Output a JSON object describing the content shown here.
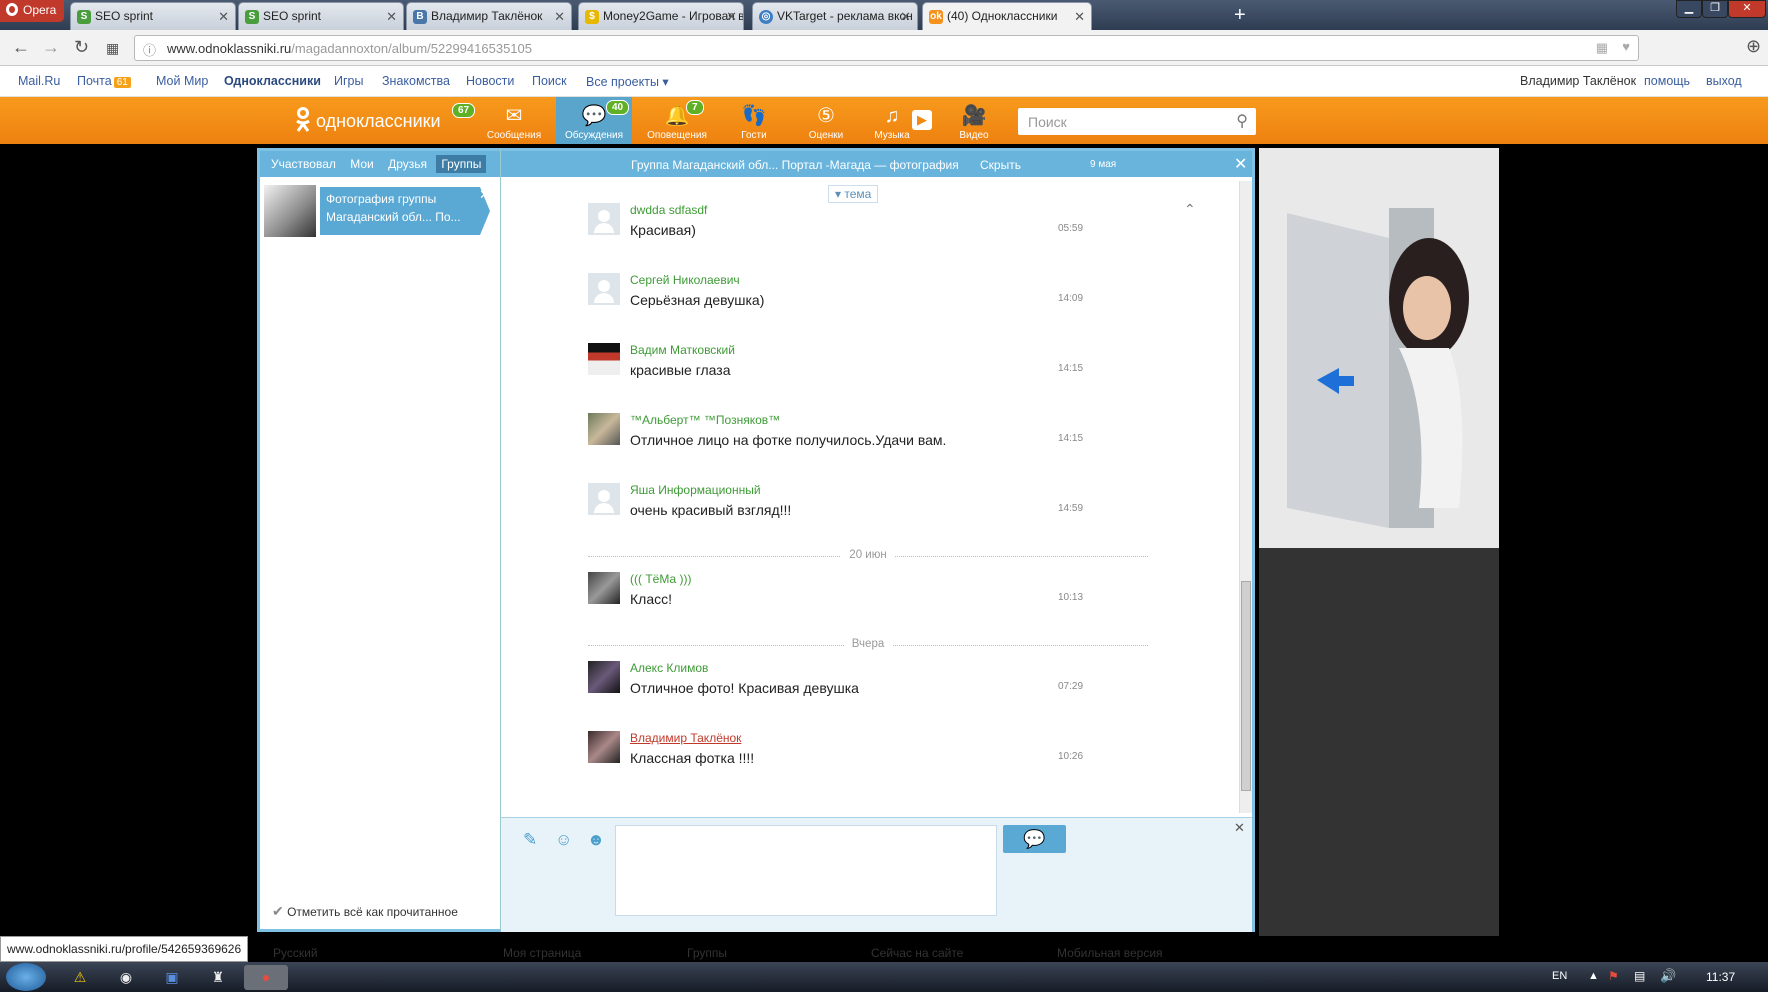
{
  "browser": {
    "app_name": "Opera",
    "tabs": [
      {
        "label": "SEO sprint",
        "icon": "seo-sprint-icon"
      },
      {
        "label": "SEO sprint",
        "icon": "seo-sprint-icon"
      },
      {
        "label": "Владимир Таклёнок",
        "icon": "vk-icon"
      },
      {
        "label": "Money2Game - Игровая в",
        "icon": "money2game-icon"
      },
      {
        "label": "VKTarget - реклама вкон",
        "icon": "vktarget-icon"
      },
      {
        "label": "(40) Одноклассники",
        "icon": "odnoklassniki-icon",
        "active": true
      }
    ],
    "url_host": "www.odnoklassniki.ru",
    "url_path": "/magadannoxton/album/52299416535105"
  },
  "portal": {
    "links": [
      "Mail.Ru",
      "Почта",
      "Мой Мир",
      "Одноклассники",
      "Игры",
      "Знакомства",
      "Новости",
      "Поиск",
      "Все проекты ▾"
    ],
    "mail_count": "61",
    "user_name": "Владимир Таклёнок",
    "help": "помощь",
    "logout": "выход"
  },
  "header": {
    "logo": "одноклассники",
    "logo_badge": "67",
    "nav": [
      {
        "label": "Сообщения",
        "icon": "envelope-icon",
        "badge": ""
      },
      {
        "label": "Обсуждения",
        "icon": "discussions-icon",
        "badge": "40"
      },
      {
        "label": "Оповещения",
        "icon": "bell-icon",
        "badge": "7"
      },
      {
        "label": "Гости",
        "icon": "footprints-icon",
        "badge": ""
      },
      {
        "label": "Оценки",
        "icon": "rating-icon",
        "badge": ""
      },
      {
        "label": "Музыка",
        "icon": "music-icon",
        "badge": ""
      },
      {
        "label": "Видео",
        "icon": "video-icon",
        "badge": ""
      }
    ],
    "search_placeholder": "Поиск"
  },
  "left": {
    "tabs": [
      "Участвовал",
      "Мои",
      "Друзья",
      "Группы"
    ],
    "conversation": "Фотография группы Магаданский обл... По...",
    "mark_all": "Отметить всё как прочитанное"
  },
  "chat": {
    "title": "Группа Магаданский обл... Портал -Магада — фотография",
    "hide": "Скрыть",
    "date": "9 мая",
    "topic_label": "▾ тема",
    "messages": [
      {
        "name": "dwdda sdfasdf",
        "text": "Красивая)",
        "time": "05:59"
      },
      {
        "name": "Сергей Николаевич",
        "text": "Серьёзная девушка)",
        "time": "14:09"
      },
      {
        "name": "Вадим Матковский",
        "text": "красивые глаза",
        "time": "14:15"
      },
      {
        "name": "™Альберт™ ™Позняков™",
        "text": "Отличное лицо на фотке получилось.Удачи вам.",
        "time": "14:15"
      },
      {
        "name": "Яша Информационный",
        "text": "очень красивый взгляд!!!",
        "time": "14:59"
      },
      {
        "name": "((( ТёМа )))",
        "text": "Класс!",
        "time": "10:13"
      },
      {
        "name": "Алекс Климов",
        "text": "Отличное фото! Красивая девушка",
        "time": "07:29"
      },
      {
        "name": "Владимир Таклёнок",
        "text": "Классная фотка !!!!",
        "time": "10:26"
      }
    ],
    "separators": [
      "20 июн",
      "Вчера"
    ]
  },
  "status_url": "www.odnoklassniki.ru/profile/542659369626",
  "footer": [
    "Русский",
    "Моя страница",
    "Группы",
    "Сейчас на сайте",
    "Мобильная версия"
  ],
  "taskbar": {
    "lang": "EN",
    "time": "11:37"
  }
}
